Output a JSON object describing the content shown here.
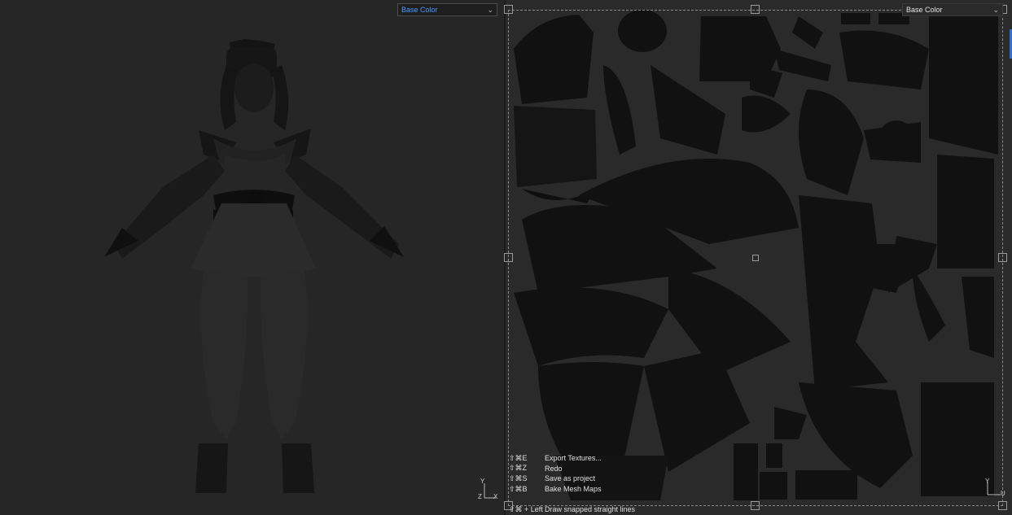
{
  "viewport_3d": {
    "channel_dropdown": {
      "value": "Base Color"
    },
    "axis_gizmo": {
      "y": "Y",
      "z": "Z",
      "x": "X"
    }
  },
  "viewport_2d": {
    "channel_dropdown": {
      "value": "Base Color"
    },
    "axis_gizmo": {
      "y": "Y",
      "u": "U"
    },
    "shortcuts": [
      {
        "keys": "⇧⌘E",
        "action": "Export Textures..."
      },
      {
        "keys": "⇧⌘Z",
        "action": "Redo"
      },
      {
        "keys": "⇧⌘S",
        "action": "Save as project"
      },
      {
        "keys": "⇧⌘B",
        "action": "Bake Mesh Maps"
      }
    ],
    "hint": {
      "keys": "⇧⌘ + Left",
      "action": "Draw snapped straight lines"
    }
  }
}
